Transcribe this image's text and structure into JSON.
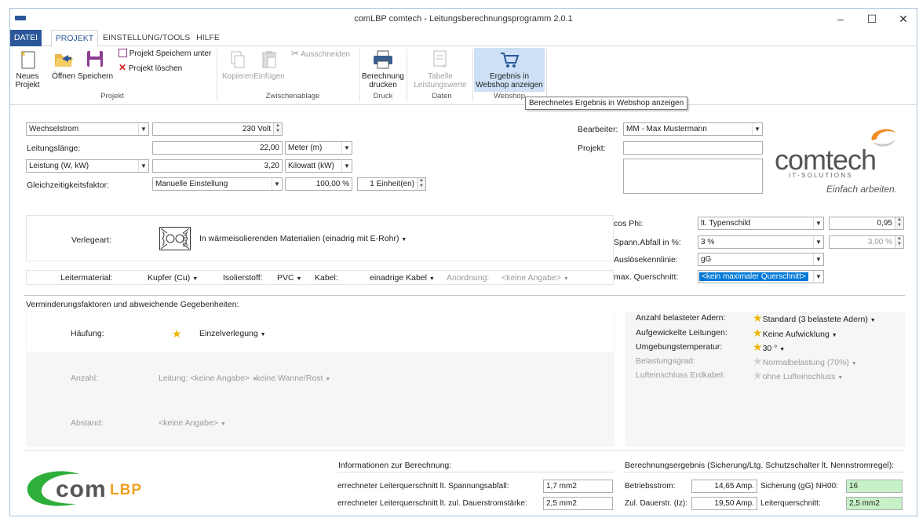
{
  "window": {
    "title": "comLBP  comtech - Leitungsberechnungsprogramm 2.0.1"
  },
  "menu": {
    "datei": "DATEI",
    "projekt": "PROJEKT",
    "einstellung": "EINSTELLUNG/TOOLS",
    "hilfe": "HILFE"
  },
  "ribbon": {
    "neues_projekt": "Neues Projekt",
    "oeffnen": "Öffnen",
    "speichern": "Speichern",
    "projekt_speichern_unter": "Projekt Speichern unter",
    "projekt_loeschen": "Projekt löschen",
    "group_projekt": "Projekt",
    "kopieren": "Kopieren",
    "einfuegen": "Einfügen",
    "ausschneiden": "Ausschneiden",
    "group_zwischenablage": "Zwischenablage",
    "berechnung_drucken": "Berechnung drucken",
    "group_druck": "Druck",
    "tabelle_leistungswerte": "Tabelle Leistungswerte",
    "group_daten": "Daten",
    "ergebnis_webshop": "Ergebnis in Webshop anzeigen",
    "group_webshop": "Webshop",
    "tooltip": "Berechnetes Ergebnis in Webshop anzeigen"
  },
  "input": {
    "stromart": "Wechselstrom",
    "spannung": "230 Volt",
    "leitungslaenge_label": "Leitungslänge:",
    "leitungslaenge": "22,00",
    "laenge_einheit": "Meter (m)",
    "leistung_typ": "Leistung (W, kW)",
    "leistung": "3,20",
    "leistung_einheit": "Kilowatt (kW)",
    "gzf_label": "Gleichzeitigkeitsfaktor:",
    "gzf_modus": "Manuelle Einstellung",
    "gzf_wert": "100,00 %",
    "einheiten": "1 Einheit(en)"
  },
  "project": {
    "bearbeiter_label": "Bearbeiter:",
    "bearbeiter": "MM - Max Mustermann",
    "projekt_label": "Projekt:",
    "projekt": ""
  },
  "logo": {
    "name": "comtech",
    "sub": "I T - S O L U T I O N S",
    "slogan": "Einfach arbeiten."
  },
  "verlegung": {
    "verlegeart_label": "Verlegeart:",
    "raum": "RAUM",
    "verlegeart": "In wärmeisolierenden Materialien (einadrig mit E-Rohr)",
    "leitermaterial_label": "Leitermaterial:",
    "leitermaterial": "Kupfer (Cu)",
    "isolierstoff_label": "Isolierstoff:",
    "isolierstoff": "PVC",
    "kabel_label": "Kabel:",
    "kabel": "einadrige Kabel",
    "anordnung_label": "Anordnung:",
    "anordnung": "<keine Angabe>"
  },
  "params": {
    "cosphi_label": "cos Phi:",
    "cosphi_modus": "lt. Typenschild",
    "cosphi": "0,95",
    "spann_label": "Spann.Abfall in %:",
    "spann_modus": "3 %",
    "spann": "3,00 %",
    "ausloese_label": "Auslösekennlinie:",
    "ausloese": "gG",
    "maxq_label": "max. Querschnitt:",
    "maxq": "<kein maximaler Querschnitt>"
  },
  "verminderung": {
    "header": "Verminderungsfaktoren und abweichende Gegebenheiten:",
    "haeufung_label": "Häufung:",
    "haeufung": "Einzelverlegung",
    "anzahl_label": "Anzahl:",
    "anzahl_leitung": "Leitung: <keine Angabe>",
    "anzahl_wanne": "keine Wanne/Rost",
    "abstand_label": "Abstand:",
    "abstand": "<keine Angabe>",
    "adern_label": "Anzahl belasteter Adern:",
    "adern": "Standard (3 belastete Adern)",
    "aufgewickelt_label": "Aufgewickelte Leitungen:",
    "aufgewickelt": "Keine Aufwicklung",
    "temp_label": "Umgebungstemperatur:",
    "temp": "30 °",
    "belastung_label": "Belastungsgrad:",
    "belastung": "Normalbelastung (70%)",
    "luft_label": "Lufteinschluss Erdkabel:",
    "luft": "ohne Lufteinschluss"
  },
  "info": {
    "header": "Informationen zur Berechnung:",
    "spannung_label": "errechneter Leiterquerschnitt lt. Spannungsabfall:",
    "spannung": "1,7 mm2",
    "dauer_label": "errechneter Leiterquerschnitt lt. zul. Dauerstromstärke:",
    "dauer": "2,5 mm2"
  },
  "result": {
    "header": "Berechnungsergebnis (Sicherung/Ltg. Schutzschalter lt. Nennstromregel):",
    "betrieb_label": "Betriebsstrom:",
    "betrieb": "14,65 Amp.",
    "sicherung_label": "Sicherung (gG) NH00:",
    "sicherung": "16",
    "dauer_label": "Zul. Dauerstr. (Iz):",
    "dauer": "19,50 Amp.",
    "querschnitt_label": "Leiterquerschnitt:",
    "querschnitt": "2,5 mm2"
  },
  "applogo": {
    "com": "com",
    "lbp": "LBP"
  }
}
